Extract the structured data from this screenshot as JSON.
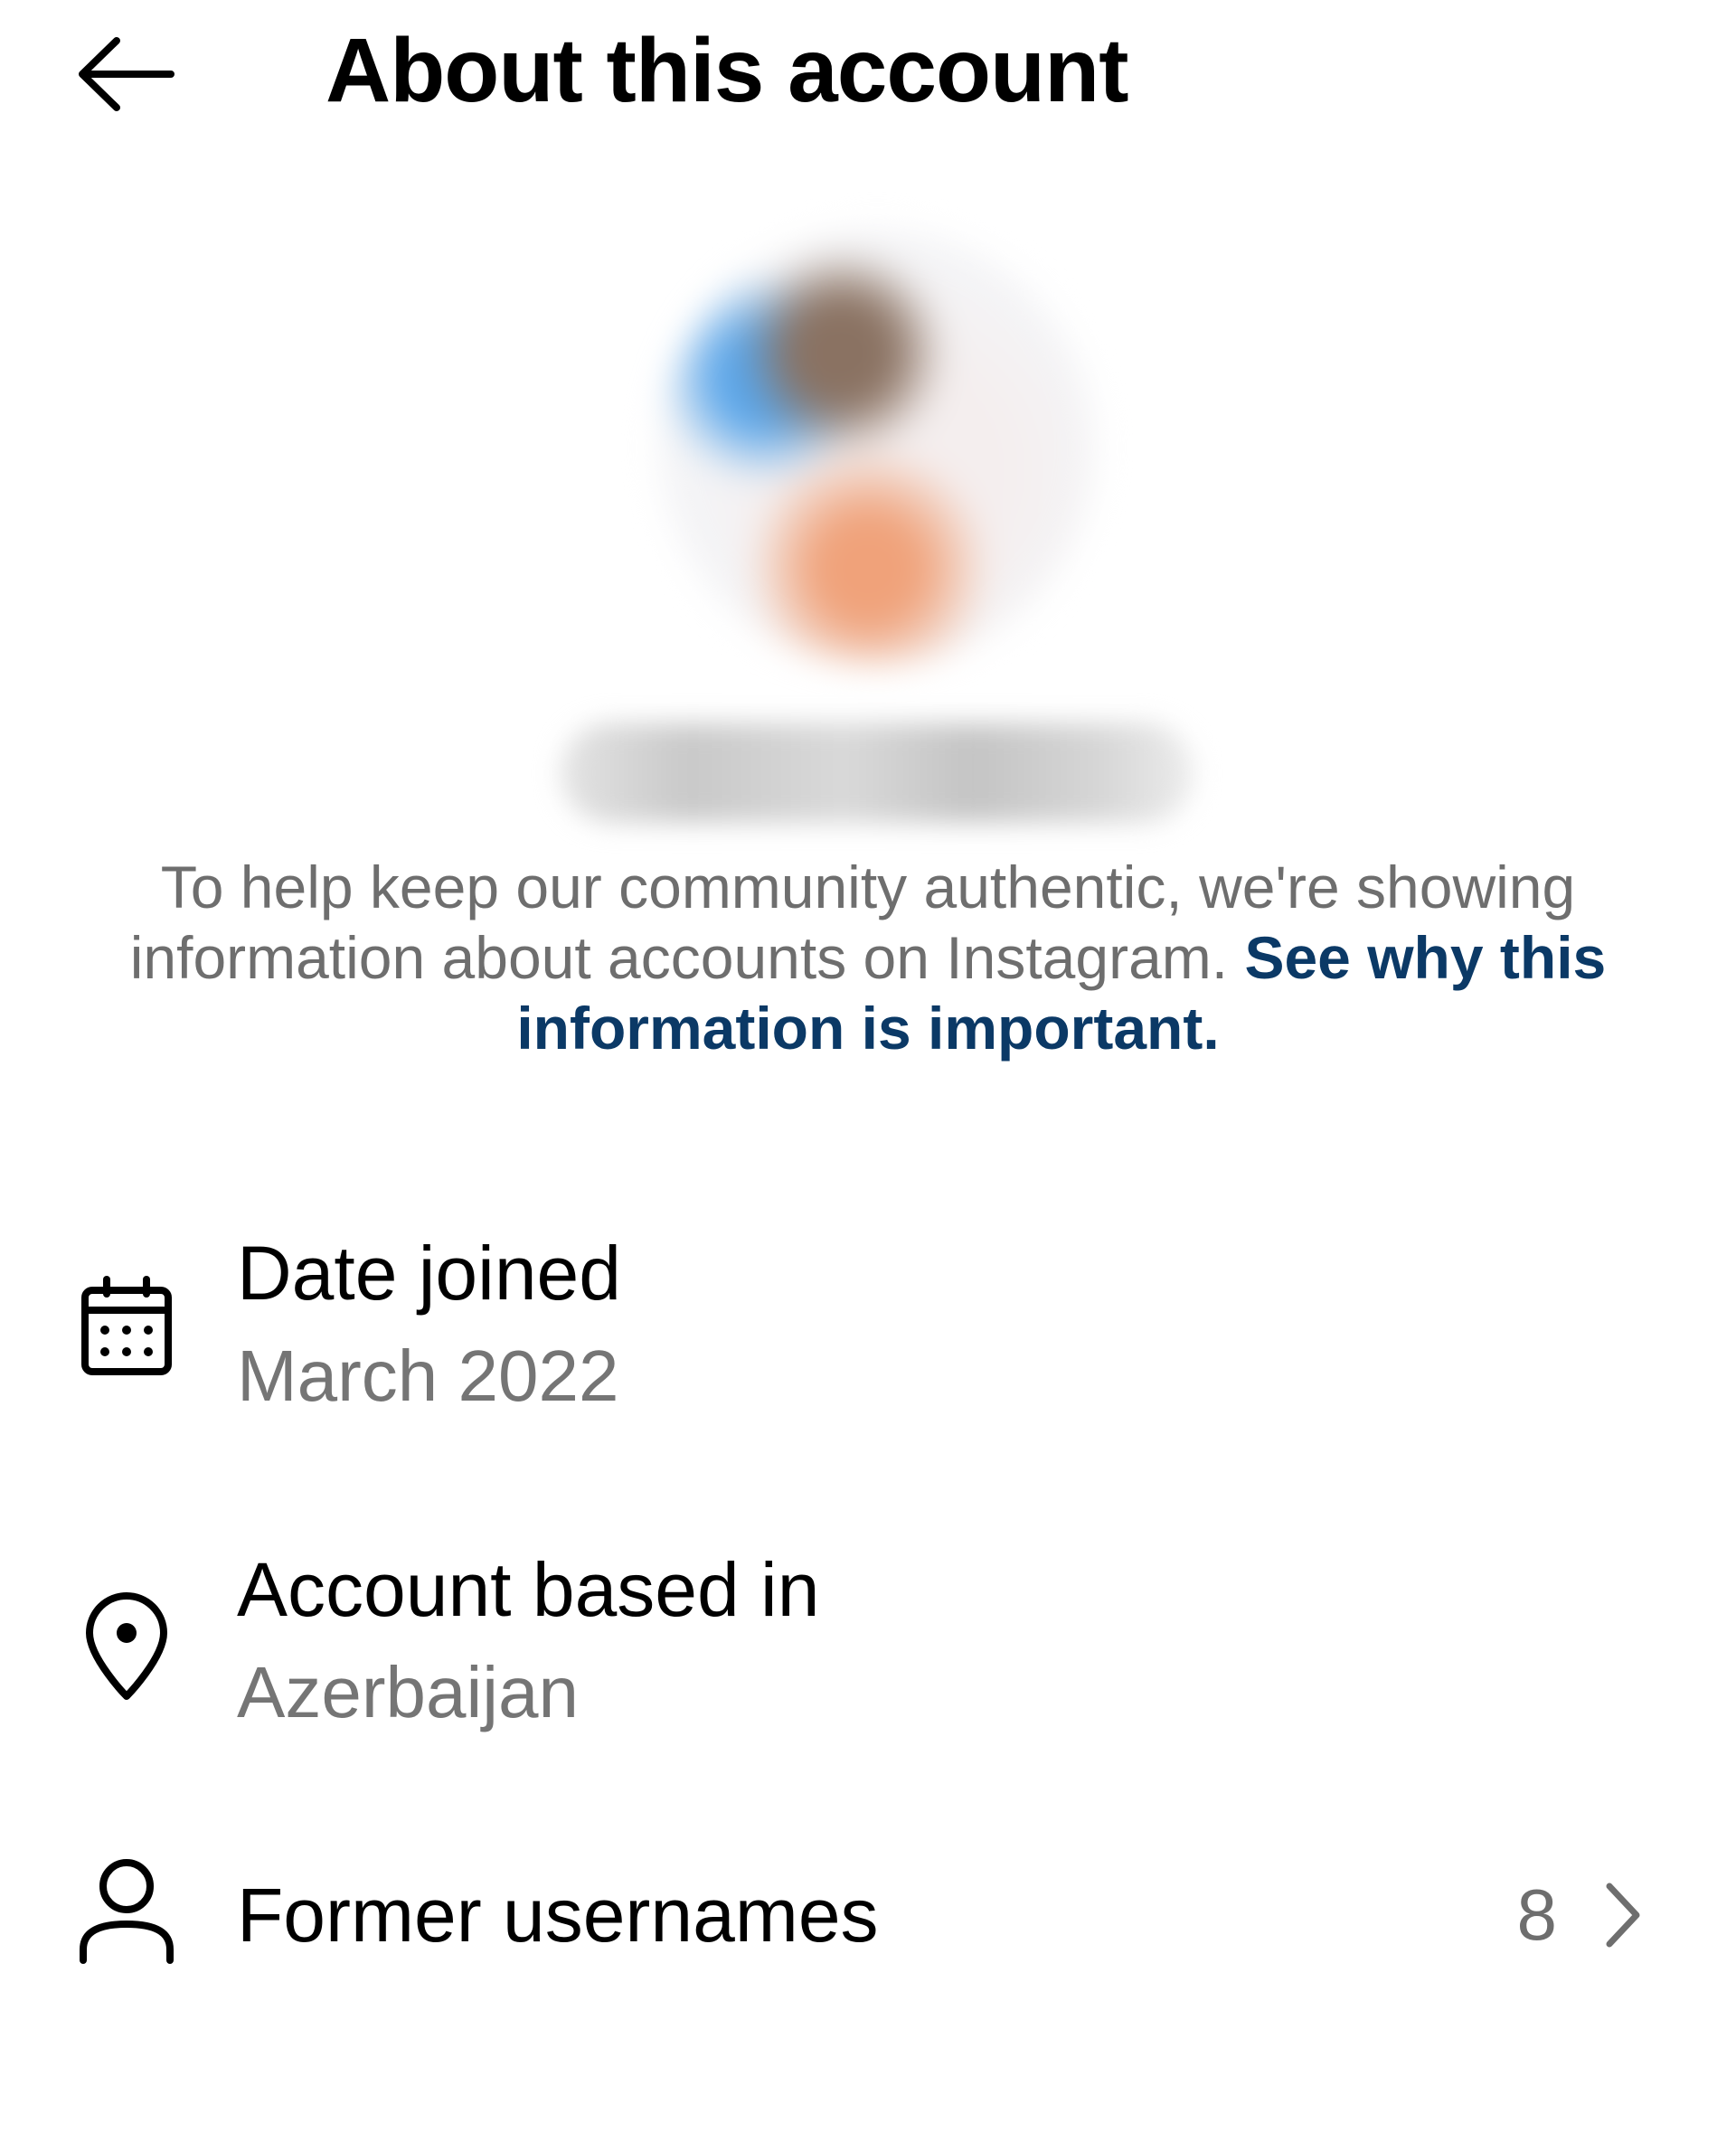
{
  "header": {
    "title": "About this account",
    "back_icon": "arrow-left-icon"
  },
  "profile": {
    "avatar": "blurred-profile-photo",
    "username": "blurred-username"
  },
  "info": {
    "text": "To help keep our community authentic, we're showing information about accounts on Instagram.",
    "link_text": "See why this information is important.",
    "link_color": "#0b3966"
  },
  "rows": [
    {
      "icon": "calendar-icon",
      "title": "Date joined",
      "value": "March 2022"
    },
    {
      "icon": "location-pin-icon",
      "title": "Account based in",
      "value": "Azerbaijan"
    },
    {
      "icon": "person-icon",
      "title": "Former usernames",
      "count": "8",
      "chevron": "chevron-right-icon"
    }
  ]
}
